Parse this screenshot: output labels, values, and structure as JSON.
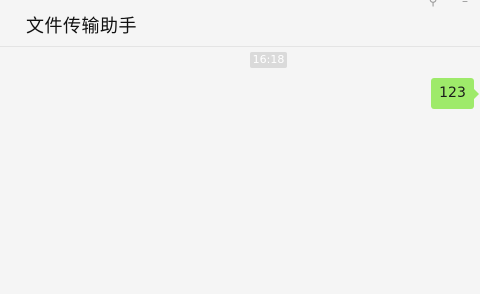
{
  "header": {
    "title": "文件传输助手"
  },
  "window_controls": [
    {
      "icon": "pin-icon",
      "glyph": "⚲"
    },
    {
      "icon": "minimize-icon",
      "glyph": "–"
    }
  ],
  "chat": {
    "time": "16:18",
    "messages": [
      {
        "from": "me",
        "text": "123",
        "color": "#9eea6a"
      }
    ]
  }
}
